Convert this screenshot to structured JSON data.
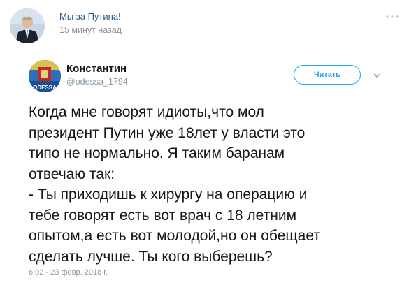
{
  "post": {
    "group_name": "Мы за Путина!",
    "time": "15 минут назад",
    "more_icon": "more-horizontal-icon"
  },
  "tweet": {
    "author_name": "Константин",
    "author_handle": "@odessa_1794",
    "avatar_text": "ODESSA",
    "follow_label": "Читать",
    "text": "Когда мне говорят идиоты,что мол\nпрезидент Путин уже 18лет у власти это\nтипо не нормально. Я таким баранам\nотвечаю так:\n- Ты приходишь к хирургу на операцию и\nтебе говорят есть вот врач с 18 летним\nопытом,а есть вот молодой,но он обещает\nсделать лучше. Ты кого выберешь?",
    "date": "6:02 - 23 февр. 2018 г."
  },
  "colors": {
    "link_blue": "#2a5885",
    "twitter_blue": "#1da1f2",
    "muted": "#8899a6"
  }
}
